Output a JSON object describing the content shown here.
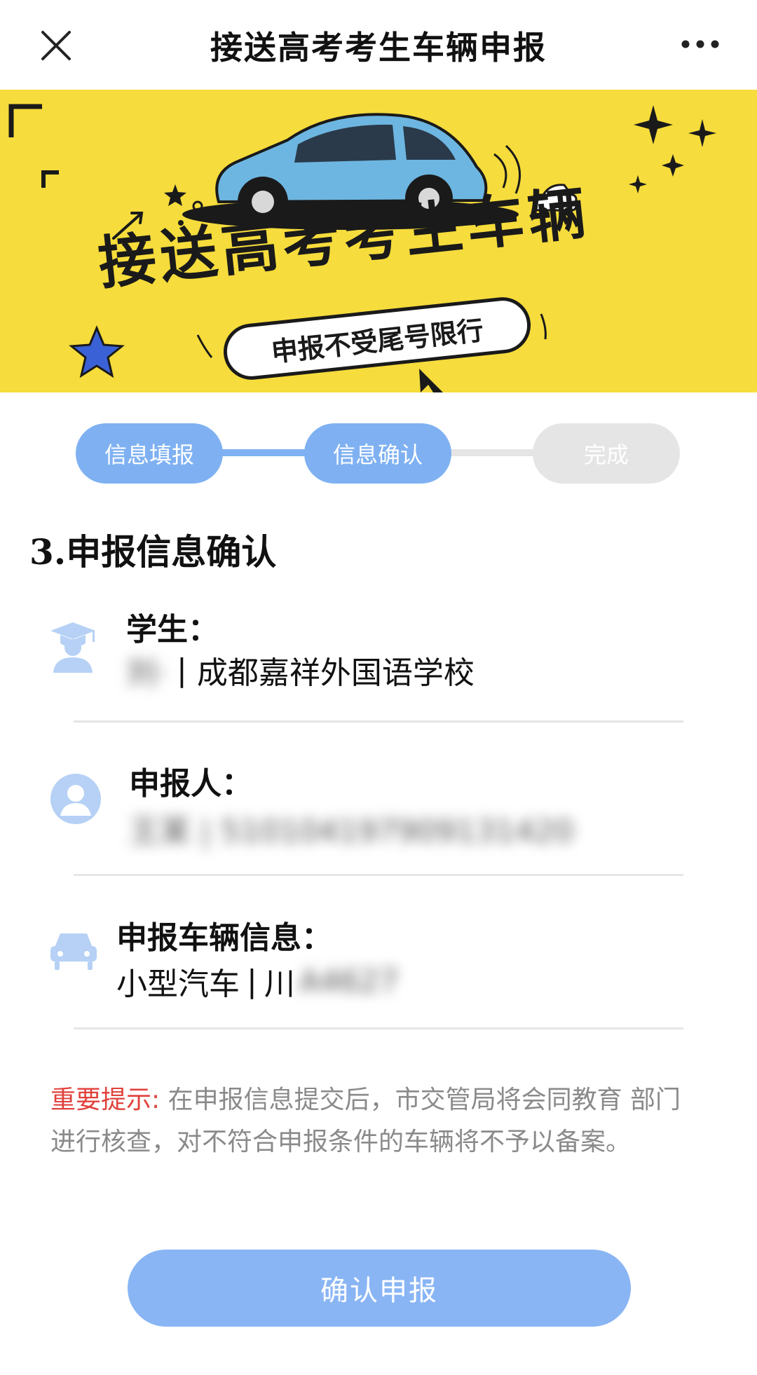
{
  "nav": {
    "title": "接送高考考生车辆申报"
  },
  "banner": {
    "title": "接送高考考生车辆",
    "subtitle": "申报不受尾号限行"
  },
  "steps": [
    {
      "label": "信息填报",
      "state": "done"
    },
    {
      "label": "信息确认",
      "state": "active"
    },
    {
      "label": "完成",
      "state": "pending"
    }
  ],
  "section_title": "3.申报信息确认",
  "info": {
    "student": {
      "icon": "graduate-icon",
      "label": "学生：",
      "name_blurred": "刘·",
      "separator": "|",
      "school": "成都嘉祥外国语学校"
    },
    "applicant": {
      "icon": "user-avatar-icon",
      "label": "申报人：",
      "value_blurred": "王某 | 510104197909131420"
    },
    "vehicle": {
      "icon": "car-icon",
      "label": "申报车辆信息：",
      "type": "小型汽车",
      "separator": "|",
      "plate_prefix": "川",
      "plate_blurred": "A4627"
    }
  },
  "notice": {
    "highlight": "重要提示:",
    "text": "在申报信息提交后，市交管局将会同教育 部门进行核查，对不符合申报条件的车辆将不予以备案。"
  },
  "confirm_button": "确认申报",
  "colors": {
    "primary": "#7fb1f2",
    "button": "#89b5f4",
    "banner_bg": "#f6dc3c",
    "notice_highlight": "#e0423c",
    "step_pending": "#e5e5e5"
  }
}
